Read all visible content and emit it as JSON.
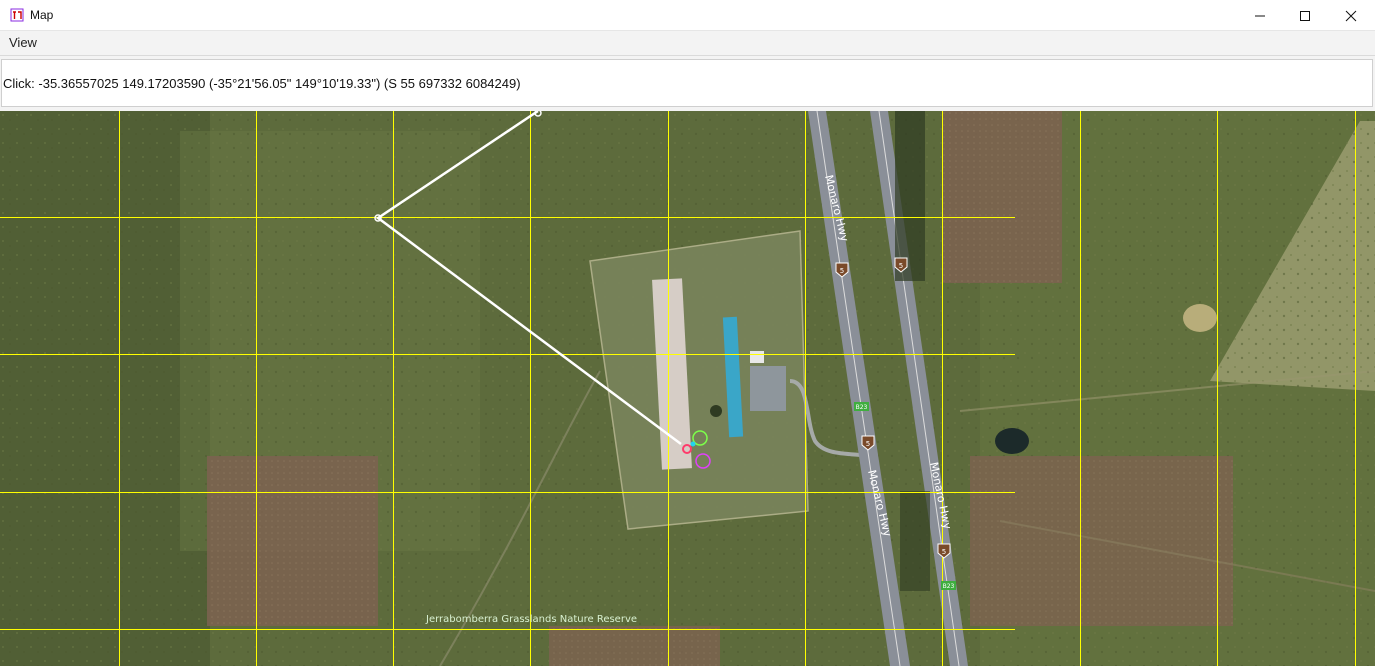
{
  "window": {
    "title": "Map",
    "icon": "app-icon",
    "controls": [
      "minimize-icon",
      "maximize-icon",
      "close-icon"
    ]
  },
  "menu": {
    "items": [
      {
        "label": "View"
      }
    ]
  },
  "status": {
    "text": "Click: -35.36557025 149.17203590 (-35°21'56.05\" 149°10'19.33\") (S 55 697332 6084249)"
  },
  "map": {
    "labels": {
      "highway_1": "Monaro Hwy",
      "highway_2": "Monaro Hwy",
      "highway_3": "Monaro Hwy",
      "highway_4": "Monaro Hwy",
      "reserve": "Jerrabomberra Grasslands Nature Reserve",
      "shield_5": "5",
      "shield_b23": "B23"
    },
    "colors": {
      "grid": "#ffff00",
      "path": "#ffffff",
      "ground": "#5d6b3c",
      "road": "#8a8f98",
      "roof": "#3aa6c8",
      "tile": "#7a6048"
    }
  }
}
